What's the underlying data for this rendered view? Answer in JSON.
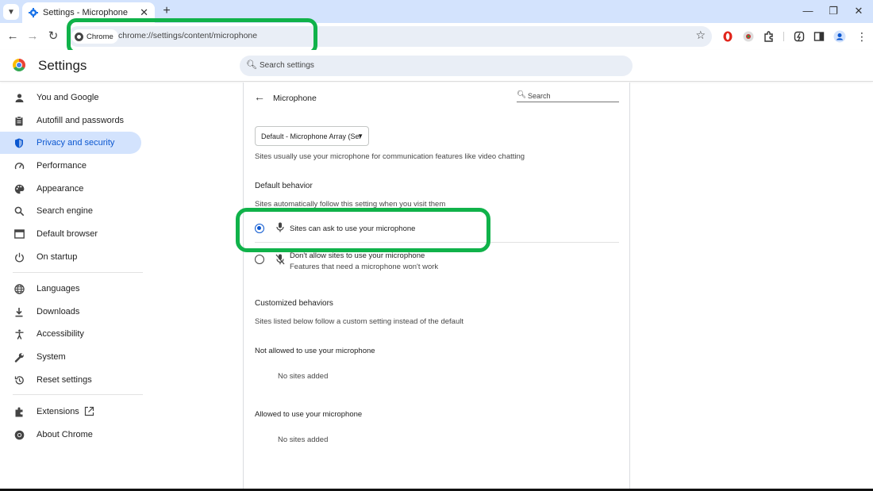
{
  "tab": {
    "title": "Settings - Microphone",
    "close": "✕",
    "new_tab": "+"
  },
  "window_controls": {
    "minimize": "—",
    "restore": "❐",
    "close": "✕"
  },
  "toolbar": {
    "chip_label": "Chrome",
    "url": "chrome://settings/content/microphone"
  },
  "header": {
    "title": "Settings",
    "search_placeholder": "Search settings"
  },
  "sidebar": {
    "items": [
      {
        "label": "You and Google",
        "icon": "person-icon"
      },
      {
        "label": "Autofill and passwords",
        "icon": "clipboard-icon"
      },
      {
        "label": "Privacy and security",
        "icon": "shield-icon",
        "active": true
      },
      {
        "label": "Performance",
        "icon": "speedometer-icon"
      },
      {
        "label": "Appearance",
        "icon": "palette-icon"
      },
      {
        "label": "Search engine",
        "icon": "search-icon"
      },
      {
        "label": "Default browser",
        "icon": "browser-icon"
      },
      {
        "label": "On startup",
        "icon": "power-icon"
      },
      {
        "label": "Languages",
        "icon": "globe-icon"
      },
      {
        "label": "Downloads",
        "icon": "download-icon"
      },
      {
        "label": "Accessibility",
        "icon": "accessibility-icon"
      },
      {
        "label": "System",
        "icon": "wrench-icon"
      },
      {
        "label": "Reset settings",
        "icon": "history-icon"
      },
      {
        "label": "Extensions",
        "icon": "puzzle-icon"
      },
      {
        "label": "About Chrome",
        "icon": "chrome-icon"
      }
    ]
  },
  "panel": {
    "title": "Microphone",
    "search_placeholder": "Search",
    "device_select": "Default - Microphone Array (Ser",
    "device_hint": "Sites usually use your microphone for communication features like video chatting",
    "default_behavior": {
      "heading": "Default behavior",
      "subheading": "Sites automatically follow this setting when you visit them",
      "options": [
        {
          "label": "Sites can ask to use your microphone",
          "checked": true
        },
        {
          "label": "Don't allow sites to use your microphone",
          "sublabel": "Features that need a microphone won't work",
          "checked": false
        }
      ]
    },
    "customized": {
      "heading": "Customized behaviors",
      "subheading": "Sites listed below follow a custom setting instead of the default",
      "not_allowed_heading": "Not allowed to use your microphone",
      "not_allowed_empty": "No sites added",
      "allowed_heading": "Allowed to use your microphone",
      "allowed_empty": "No sites added"
    }
  },
  "colors": {
    "accent": "#0b57d0",
    "highlight": "#10b24a",
    "active_bg": "#d3e3fd"
  }
}
